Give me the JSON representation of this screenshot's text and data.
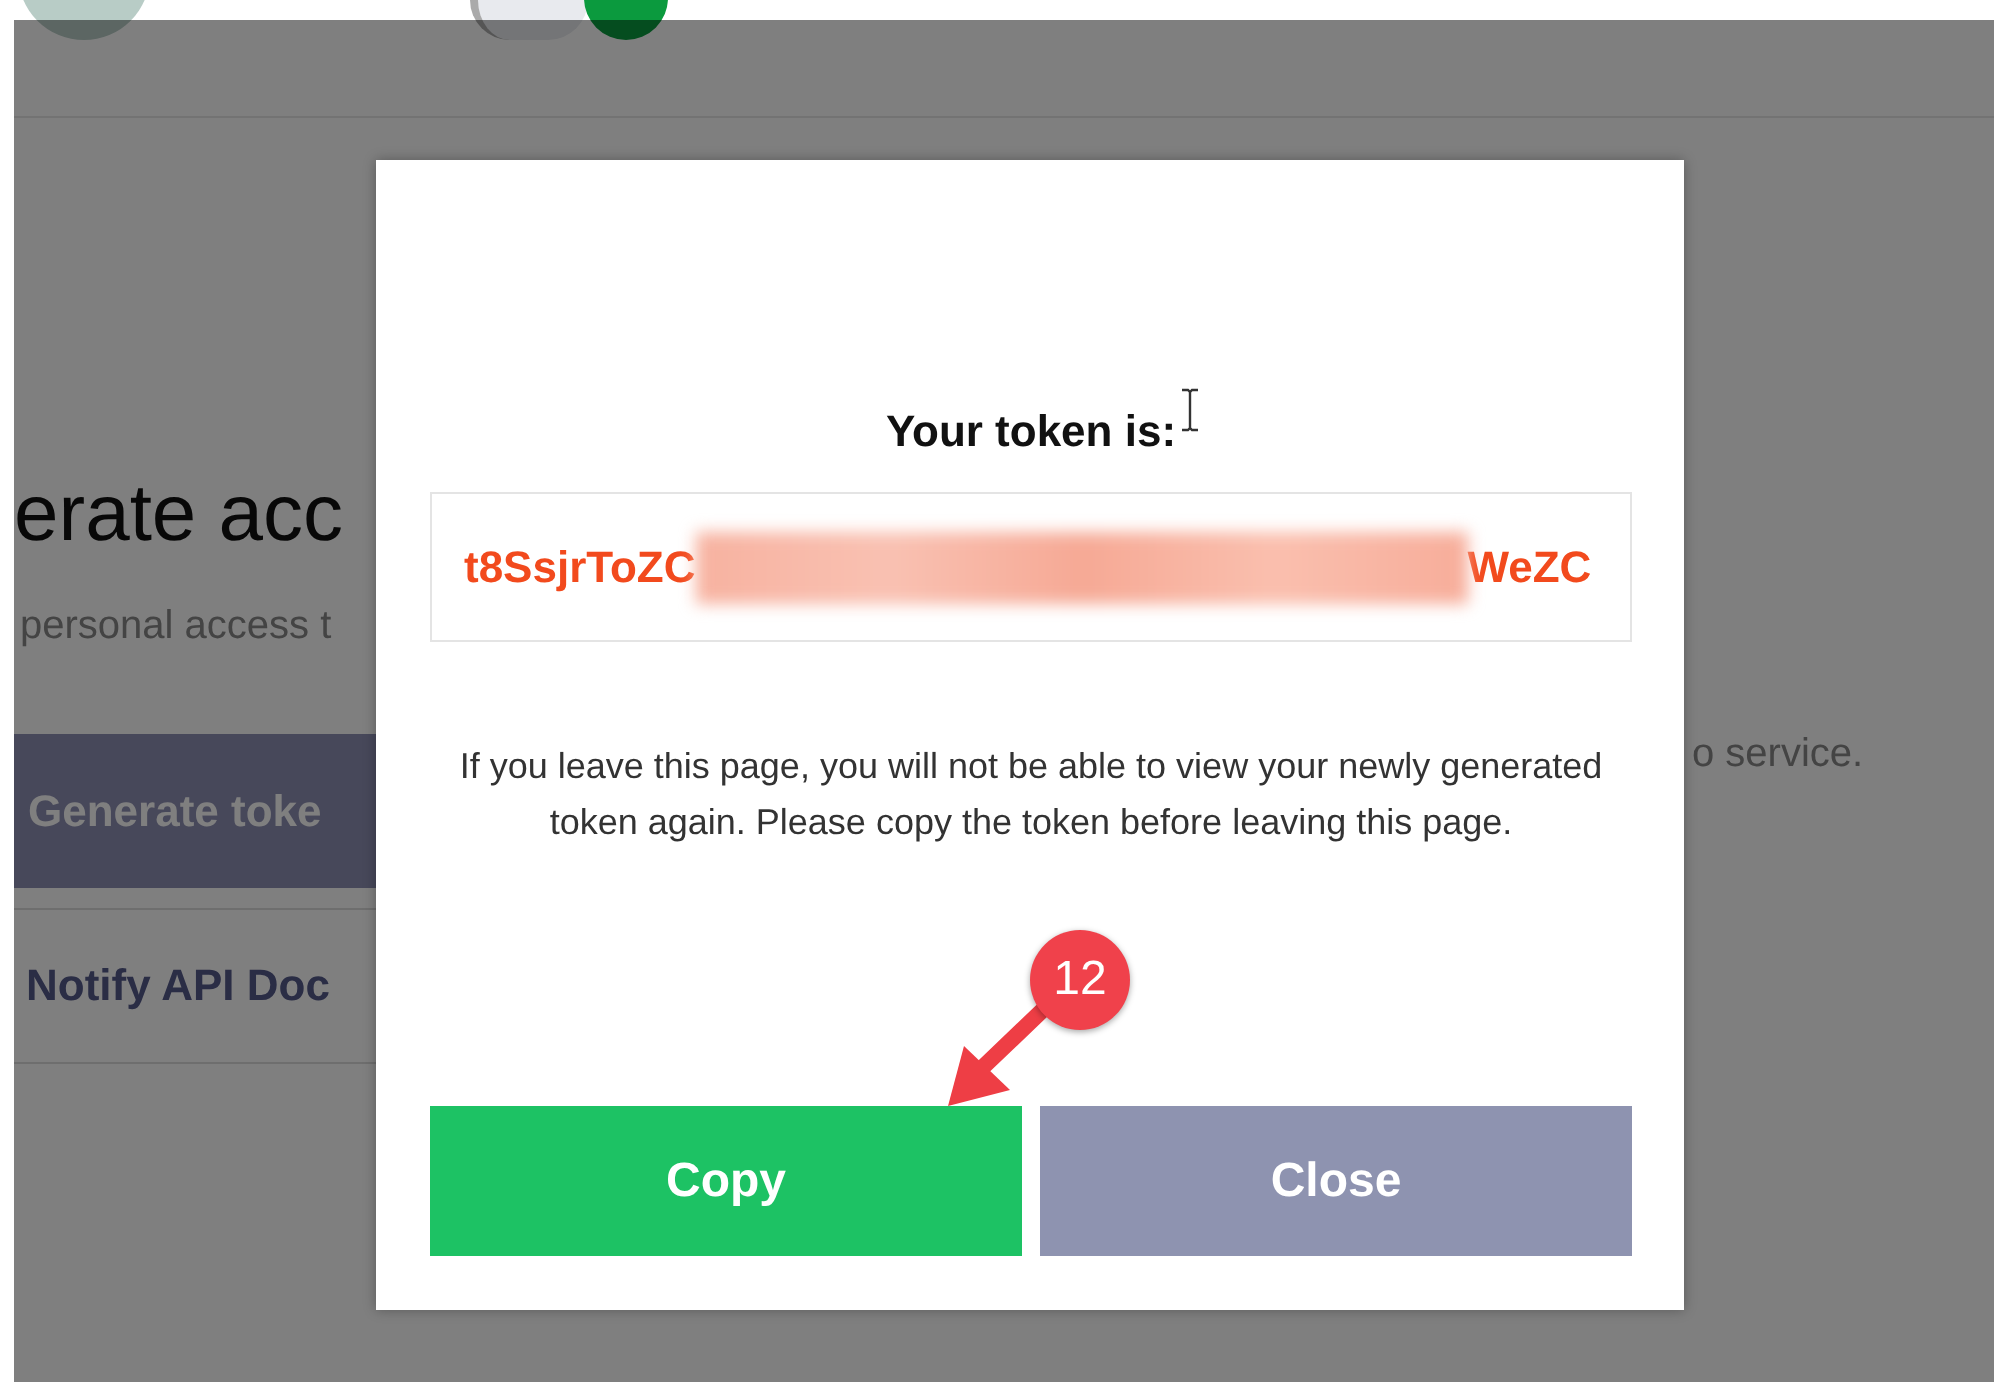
{
  "background_page": {
    "heading": "erate acc",
    "description_left": "personal access t",
    "description_right": "o service.",
    "generate_button": "Generate toke",
    "docs_link": "Notify API Doc"
  },
  "dialog": {
    "title": "Your token is:",
    "token_start": "t8SsjrToZC",
    "token_end": "WeZC",
    "message": "If you leave this page, you will not be able to view your newly generated token again. Please copy the token before leaving this page.",
    "buttons": [
      {
        "label": "Copy",
        "kind": "primary"
      },
      {
        "label": "Close",
        "kind": "secondary"
      }
    ]
  },
  "annotation": {
    "badge": "12"
  }
}
